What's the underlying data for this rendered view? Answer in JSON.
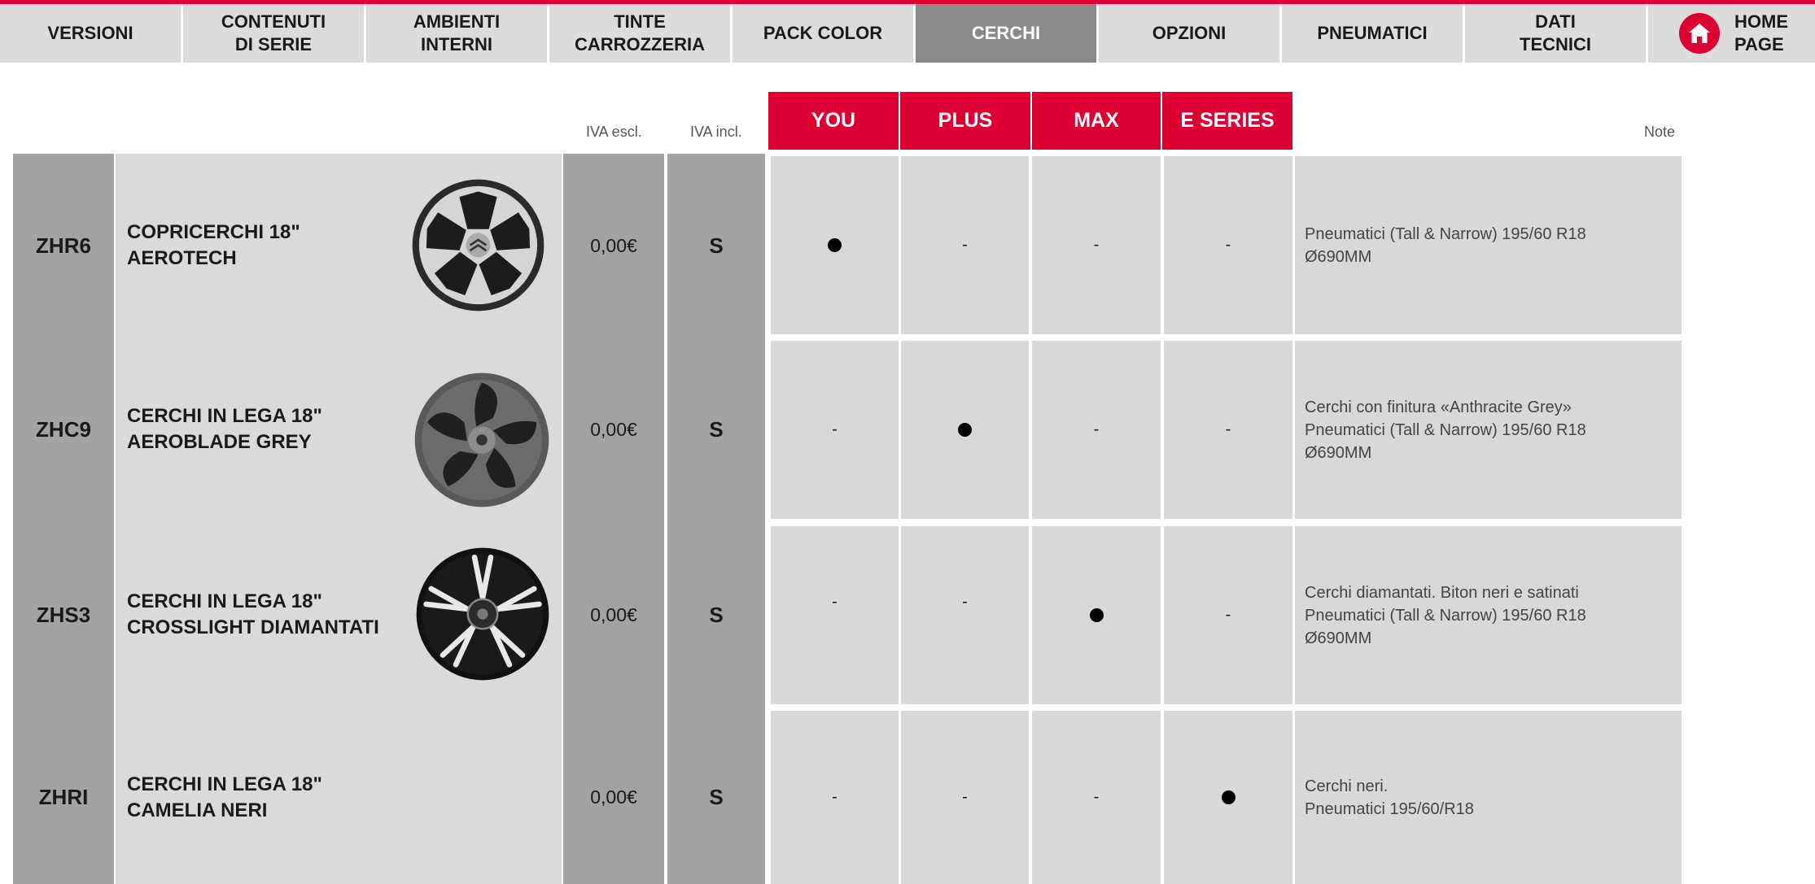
{
  "nav": {
    "items": [
      {
        "label": "VERSIONI",
        "active": false
      },
      {
        "label": "CONTENUTI\nDI SERIE",
        "active": false
      },
      {
        "label": "AMBIENTI\nINTERNI",
        "active": false
      },
      {
        "label": "TINTE\nCARROZZERIA",
        "active": false
      },
      {
        "label": "PACK COLOR",
        "active": false
      },
      {
        "label": "CERCHI",
        "active": true
      },
      {
        "label": "OPZIONI",
        "active": false
      },
      {
        "label": "PNEUMATICI",
        "active": false
      },
      {
        "label": "DATI\nTECNICI",
        "active": false
      }
    ],
    "home_label": "HOME\nPAGE",
    "home_icon": "home-icon"
  },
  "table": {
    "iva_escl_label": "IVA escl.",
    "iva_incl_label": "IVA incl.",
    "note_label": "Note",
    "versions": [
      "YOU",
      "PLUS",
      "MAX",
      "E SERIES"
    ],
    "rows": [
      {
        "code": "ZHR6",
        "description": "COPRICERCHI 18\"\nAEROTECH",
        "wheel_icon": "wheel-aerotech-image",
        "price_excl": "0,00€",
        "price_incl": "S",
        "availability": [
          "●",
          "-",
          "-",
          "-"
        ],
        "note": "Pneumatici (Tall & Narrow) 195/60 R18\nØ690MM"
      },
      {
        "code": "ZHC9",
        "description": "CERCHI IN LEGA 18\"\nAEROBLADE GREY",
        "wheel_icon": "wheel-aeroblade-image",
        "price_excl": "0,00€",
        "price_incl": "S",
        "availability": [
          "-",
          "●",
          "-",
          "-"
        ],
        "note": "Cerchi con finitura «Anthracite Grey»\nPneumatici (Tall & Narrow) 195/60 R18\nØ690MM"
      },
      {
        "code": "ZHS3",
        "description": "CERCHI IN LEGA 18\"\nCROSSLIGHT DIAMANTATI",
        "wheel_icon": "wheel-crosslight-image",
        "price_excl": "0,00€",
        "price_incl": "S",
        "availability": [
          "-",
          "-",
          "●",
          "-"
        ],
        "note": "Cerchi diamantati. Biton neri e satinati\nPneumatici (Tall & Narrow) 195/60 R18\nØ690MM"
      },
      {
        "code": "ZHRI",
        "description": "CERCHI IN LEGA 18\"\nCAMELIA NERI",
        "wheel_icon": "",
        "price_excl": "0,00€",
        "price_incl": "S",
        "availability": [
          "-",
          "-",
          "-",
          "●"
        ],
        "note": "Cerchi neri.\nPneumatici 195/60/R18"
      }
    ]
  },
  "colors": {
    "accent": "#dc0032",
    "nav_bg": "#dcdcdc",
    "nav_active": "#8a8a8a",
    "cell_bg": "#d8d8d8",
    "dark_col": "#a3a3a3"
  }
}
